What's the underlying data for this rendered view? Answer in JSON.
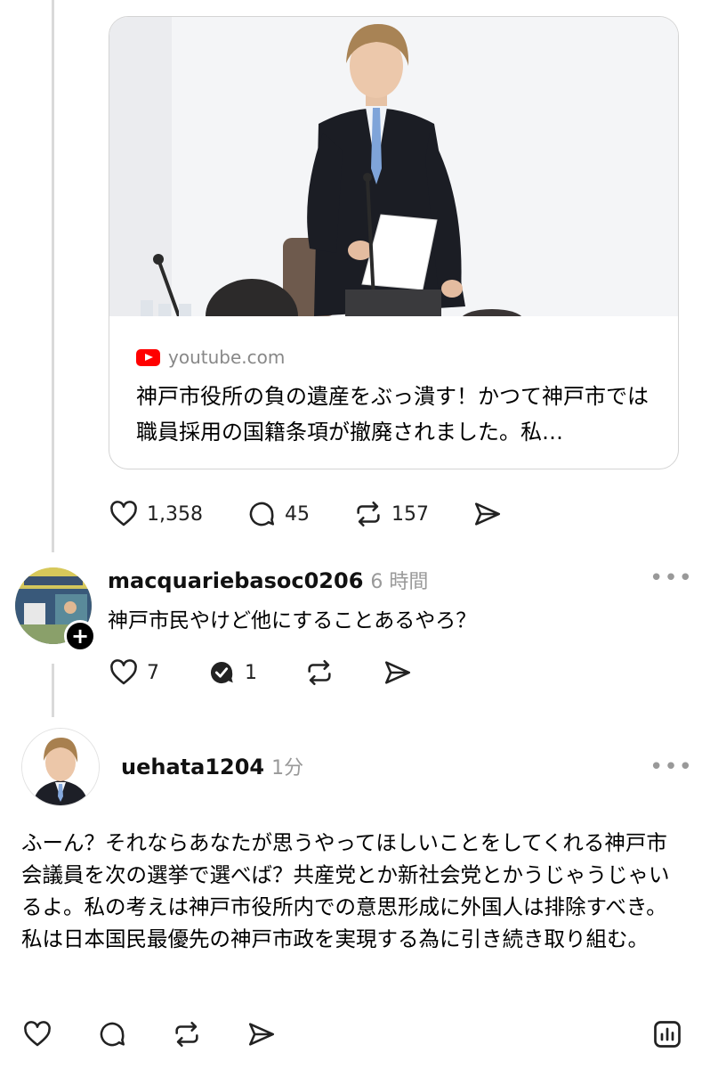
{
  "post": {
    "link_card": {
      "source": "youtube.com",
      "title": "神戸市役所の負の遺産をぶっ潰す！かつて神戸市では職員採用の国籍条項が撤廃されました。私…"
    },
    "likes": "1,358",
    "comments": "45",
    "reposts": "157"
  },
  "reply1": {
    "username": "macquariebasoc0206",
    "time": "6 時間",
    "text": "神戸市民やけど他にすることあるやろ？",
    "likes": "7",
    "comments": "1"
  },
  "reply2": {
    "username": "uehata1204",
    "time": "1分",
    "text": "ふーん？それならあなたが思うやってほしいことをしてくれる神戸市会議員を次の選挙で選べば？共産党とか新社会党とかうじゃうじゃいるよ。私の考えは神戸市役所内での意思形成に外国人は排除すべき。私は日本国民最優先の神戸市政を実現する為に引き続き取り組む。"
  },
  "colors": {
    "youtube_red": "#ff0000",
    "muted": "#999999",
    "thread_line": "#d9d9d9"
  }
}
